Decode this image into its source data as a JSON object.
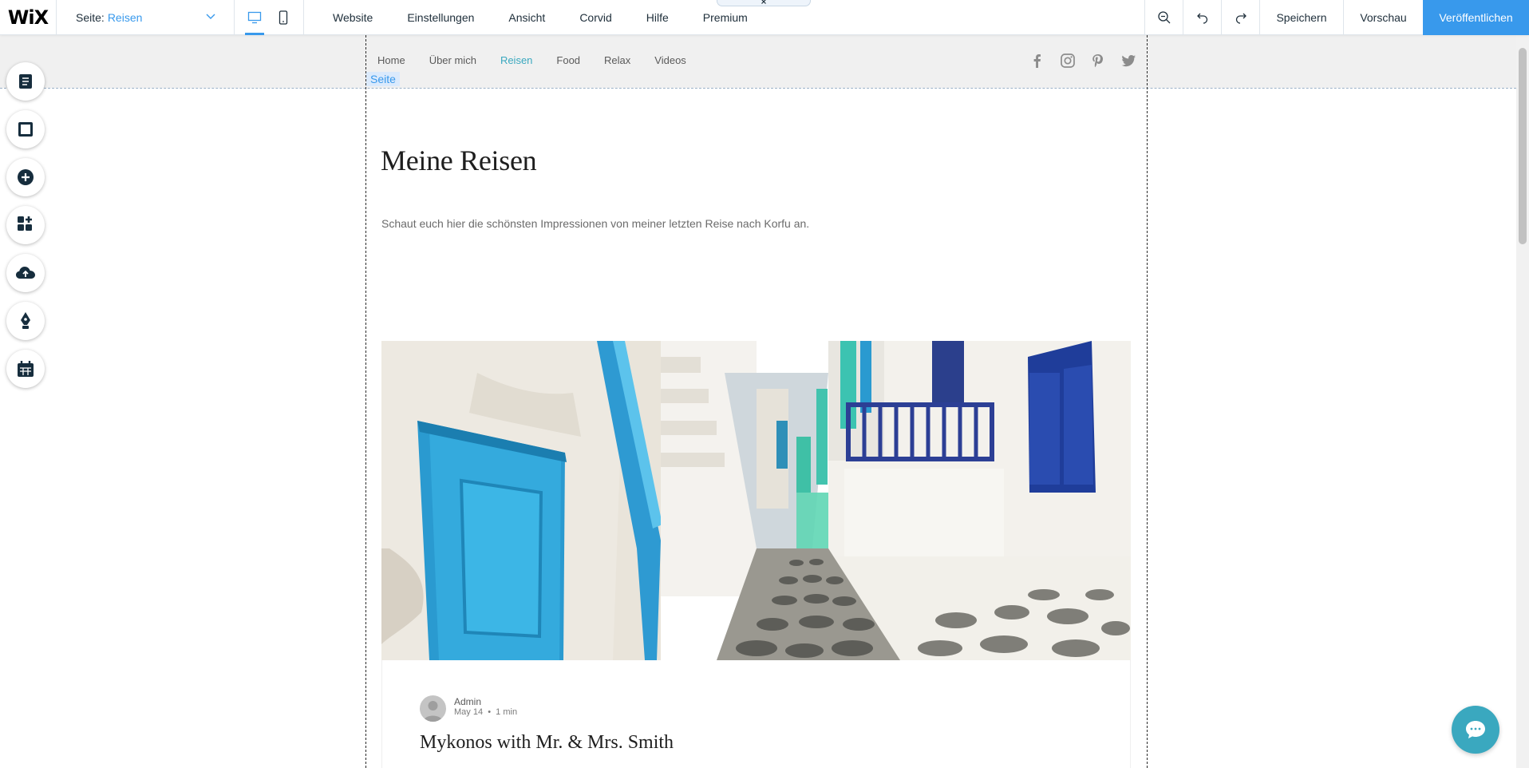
{
  "topbar": {
    "logo": "WiX",
    "page_label": "Seite:",
    "page_value": "Reisen",
    "menu": [
      "Website",
      "Einstellungen",
      "Ansicht",
      "Corvid",
      "Hilfe",
      "Premium"
    ],
    "save": "Speichern",
    "preview": "Vorschau",
    "publish": "Veröffentlichen"
  },
  "site": {
    "nav": [
      "Home",
      "Über mich",
      "Reisen",
      "Food",
      "Relax",
      "Videos"
    ],
    "active_nav": "Reisen",
    "social": [
      "facebook-icon",
      "instagram-icon",
      "pinterest-icon",
      "twitter-icon"
    ],
    "section_tag": "Seite",
    "heading": "Meine Reisen",
    "intro": "Schaut euch hier die schönsten Impressionen von meiner letzten Reise nach Korfu an."
  },
  "post": {
    "author": "Admin",
    "date": "May 14",
    "read_time": "1 min",
    "title": "Mykonos with Mr. & Mrs. Smith"
  },
  "rail": [
    "pages-icon",
    "background-icon",
    "add-icon",
    "app-market-icon",
    "upload-icon",
    "blog-icon",
    "bookings-icon"
  ],
  "colors": {
    "accent": "#3899ec",
    "active_nav": "#3aa8bf",
    "chat": "#3aa8bf"
  }
}
